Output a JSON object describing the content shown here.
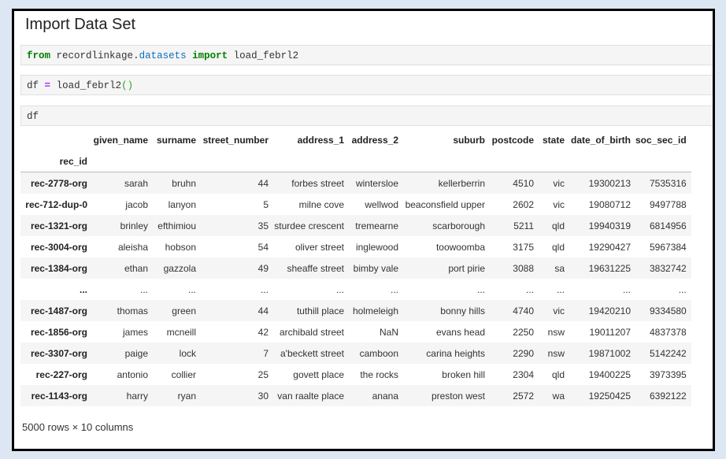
{
  "title": "Import Data Set",
  "cells": {
    "c1": {
      "kw1": "from",
      "mod1": "recordlinkage",
      "dot": ".",
      "mod2": "datasets",
      "kw2": "import",
      "name": "load_febrl2"
    },
    "c2": {
      "var": "df",
      "op": "=",
      "fn": "load_febrl2",
      "paren": "()"
    },
    "c3": {
      "text": "df"
    }
  },
  "table": {
    "columns": [
      "given_name",
      "surname",
      "street_number",
      "address_1",
      "address_2",
      "suburb",
      "postcode",
      "state",
      "date_of_birth",
      "soc_sec_id"
    ],
    "index_name": "rec_id",
    "rows": [
      [
        "rec-2778-org",
        "sarah",
        "bruhn",
        "44",
        "forbes street",
        "wintersloe",
        "kellerberrin",
        "4510",
        "vic",
        "19300213",
        "7535316"
      ],
      [
        "rec-712-dup-0",
        "jacob",
        "lanyon",
        "5",
        "milne cove",
        "wellwod",
        "beaconsfield upper",
        "2602",
        "vic",
        "19080712",
        "9497788"
      ],
      [
        "rec-1321-org",
        "brinley",
        "efthimiou",
        "35",
        "sturdee crescent",
        "tremearne",
        "scarborough",
        "5211",
        "qld",
        "19940319",
        "6814956"
      ],
      [
        "rec-3004-org",
        "aleisha",
        "hobson",
        "54",
        "oliver street",
        "inglewood",
        "toowoomba",
        "3175",
        "qld",
        "19290427",
        "5967384"
      ],
      [
        "rec-1384-org",
        "ethan",
        "gazzola",
        "49",
        "sheaffe street",
        "bimby vale",
        "port pirie",
        "3088",
        "sa",
        "19631225",
        "3832742"
      ],
      [
        "...",
        "...",
        "...",
        "...",
        "...",
        "...",
        "...",
        "...",
        "...",
        "...",
        "..."
      ],
      [
        "rec-1487-org",
        "thomas",
        "green",
        "44",
        "tuthill place",
        "holmeleigh",
        "bonny hills",
        "4740",
        "vic",
        "19420210",
        "9334580"
      ],
      [
        "rec-1856-org",
        "james",
        "mcneill",
        "42",
        "archibald street",
        "NaN",
        "evans head",
        "2250",
        "nsw",
        "19011207",
        "4837378"
      ],
      [
        "rec-3307-org",
        "paige",
        "lock",
        "7",
        "a'beckett street",
        "camboon",
        "carina heights",
        "2290",
        "nsw",
        "19871002",
        "5142242"
      ],
      [
        "rec-227-org",
        "antonio",
        "collier",
        "25",
        "govett place",
        "the rocks",
        "broken hill",
        "2304",
        "qld",
        "19400225",
        "3973395"
      ],
      [
        "rec-1143-org",
        "harry",
        "ryan",
        "30",
        "van raalte place",
        "anana",
        "preston west",
        "2572",
        "wa",
        "19250425",
        "6392122"
      ]
    ]
  },
  "footer": "5000 rows × 10 columns"
}
